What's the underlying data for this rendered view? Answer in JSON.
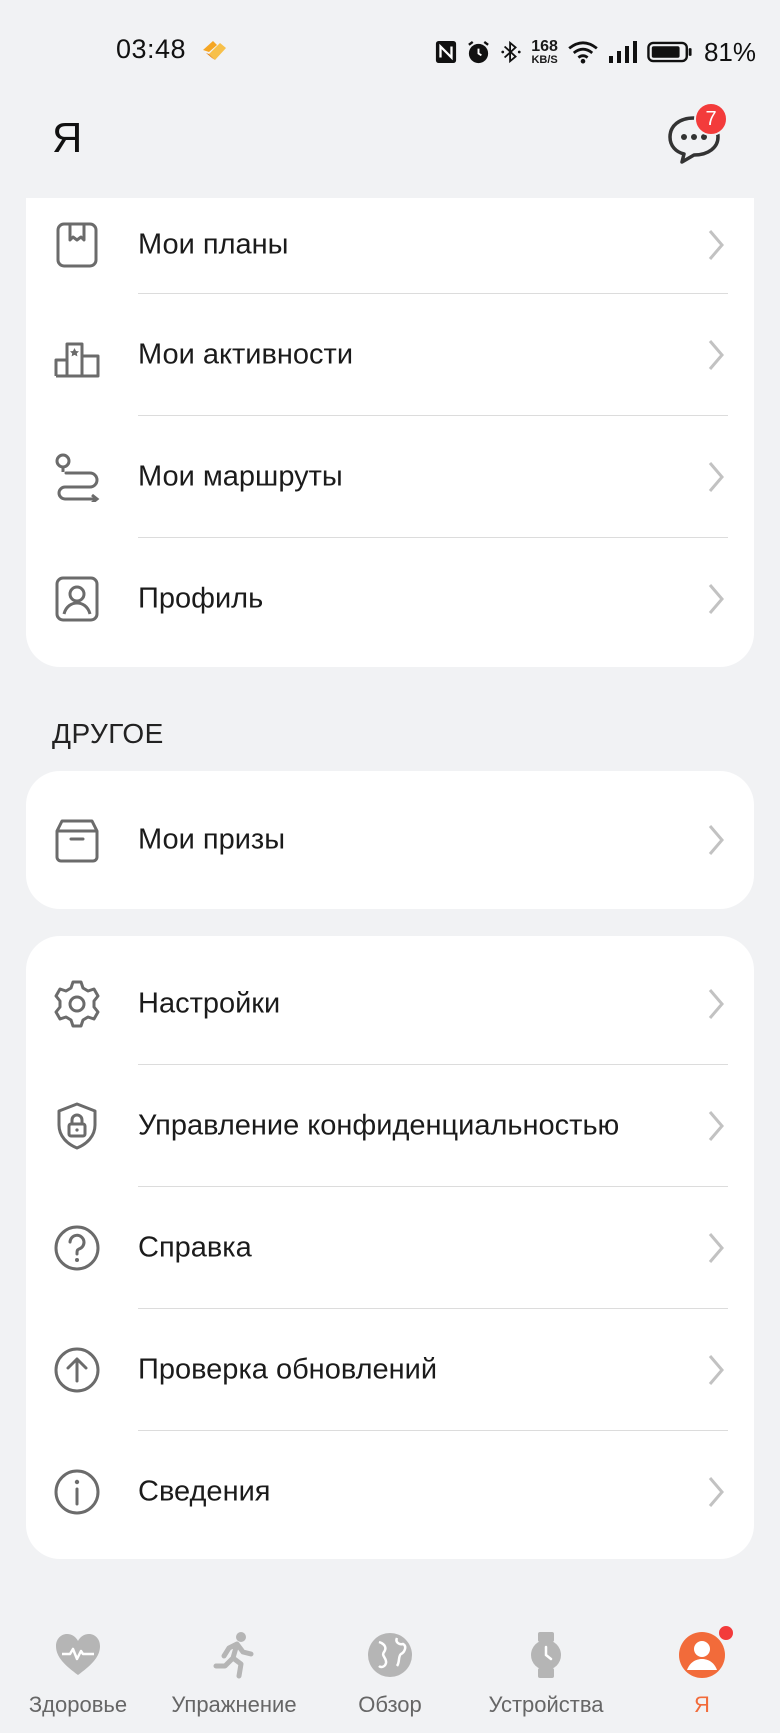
{
  "status_bar": {
    "time": "03:48",
    "net_speed_value": "168",
    "net_speed_unit": "KB/S",
    "battery_percent": "81%",
    "icons": [
      "health-app-icon",
      "nfc-icon",
      "alarm-icon",
      "bluetooth-icon",
      "wifi-icon",
      "signal-icon",
      "battery-icon"
    ]
  },
  "header": {
    "title": "Я",
    "messages_badge": "7"
  },
  "card_main": {
    "items": [
      {
        "label": "Мои планы",
        "icon": "plan-icon"
      },
      {
        "label": "Мои активности",
        "icon": "activities-podium-icon"
      },
      {
        "label": "Мои маршруты",
        "icon": "route-icon"
      },
      {
        "label": "Профиль",
        "icon": "profile-icon"
      }
    ]
  },
  "section_other": {
    "title": "ДРУГОЕ"
  },
  "card_other": {
    "items": [
      {
        "label": "Мои призы",
        "icon": "prize-box-icon"
      }
    ]
  },
  "card_settings": {
    "items": [
      {
        "label": "Настройки",
        "icon": "gear-icon"
      },
      {
        "label": "Управление конфиденциальностью",
        "icon": "privacy-shield-icon"
      },
      {
        "label": "Справка",
        "icon": "help-icon"
      },
      {
        "label": "Проверка обновлений",
        "icon": "update-arrow-icon"
      },
      {
        "label": "Сведения",
        "icon": "info-icon"
      }
    ]
  },
  "bottom_nav": {
    "items": [
      {
        "label": "Здоровье",
        "icon": "health-heart-icon"
      },
      {
        "label": "Упражнение",
        "icon": "running-icon"
      },
      {
        "label": "Обзор",
        "icon": "globe-icon"
      },
      {
        "label": "Устройства",
        "icon": "watch-icon"
      },
      {
        "label": "Я",
        "icon": "me-avatar-icon"
      }
    ],
    "active": "Я"
  },
  "colors": {
    "accent": "#f26b3a",
    "badge": "#f33b3b",
    "background": "#f1f2f4",
    "card": "#ffffff",
    "icon_gray": "#6b6b6b"
  }
}
